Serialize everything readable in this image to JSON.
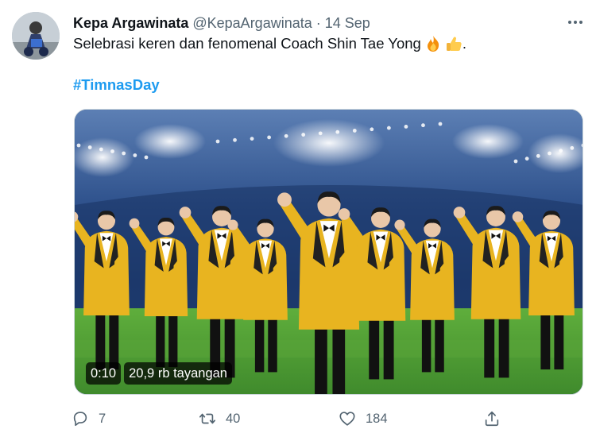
{
  "tweet": {
    "author": {
      "display_name": "Kepa Argawinata",
      "handle": "@KepaArgawinata",
      "separator": "·",
      "date": "14 Sep"
    },
    "text": "Selebrasi keren dan fenomenal Coach Shin Tae Yong",
    "emojis": [
      "fire-emoji",
      "thumbs-up-emoji"
    ],
    "text_suffix": ".",
    "hashtag": "#TimnasDay",
    "media": {
      "type": "video",
      "time": "0:10",
      "views": "20,9 rb tayangan"
    },
    "actions": {
      "replies": "7",
      "retweets": "40",
      "likes": "184"
    }
  },
  "icons": {
    "more": "more-horizontal-icon",
    "reply": "reply-icon",
    "retweet": "retweet-icon",
    "like": "heart-icon",
    "share": "share-icon"
  },
  "colors": {
    "link": "#1d9bf0",
    "secondary_text": "#536471",
    "suit_yellow": "#e8b420",
    "stadium_blue": "#1d3a6e"
  }
}
